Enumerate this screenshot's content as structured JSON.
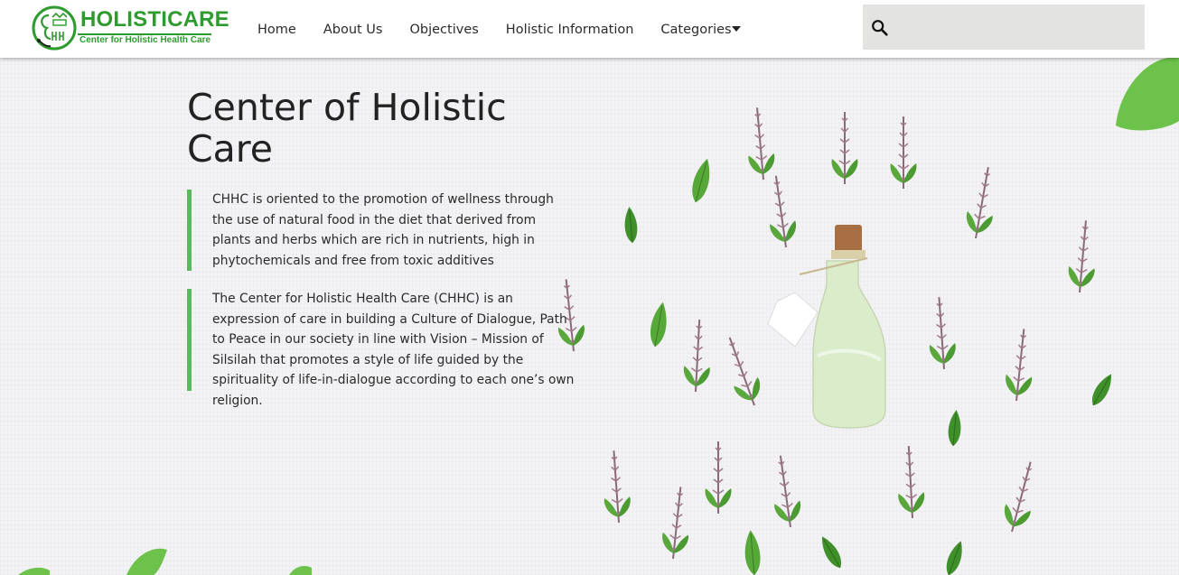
{
  "brand": {
    "name": "HOLISTICARE",
    "tagline": "Center for Holistic Health Care",
    "color": "#2e9b2f"
  },
  "nav": {
    "items": [
      {
        "label": "Home"
      },
      {
        "label": "About Us"
      },
      {
        "label": "Objectives"
      },
      {
        "label": "Holistic Information"
      },
      {
        "label": "Categories"
      }
    ],
    "dropdown_icon": "caret-down-icon"
  },
  "search": {
    "icon": "search-icon",
    "value": "",
    "placeholder": ""
  },
  "hero": {
    "title": "Center of Holistic Care",
    "paragraphs": [
      "CHHC is oriented to the promotion of wellness through the use of natural food in the diet that derived from plants and herbs which are rich in nutrients, high in phytochemicals and free from toxic additives",
      "The Center for Holistic Health Care (CHHC) is an expression of care in building a Culture of Dialogue, Path to Peace in our society in line with Vision – Mission of Silsilah that promotes a style of life guided by the spirituality of life-in-dialogue according to each one’s own religion."
    ],
    "accent_color": "#5cb85c",
    "background_image": "herbs-and-oil-bottle-illustration"
  }
}
